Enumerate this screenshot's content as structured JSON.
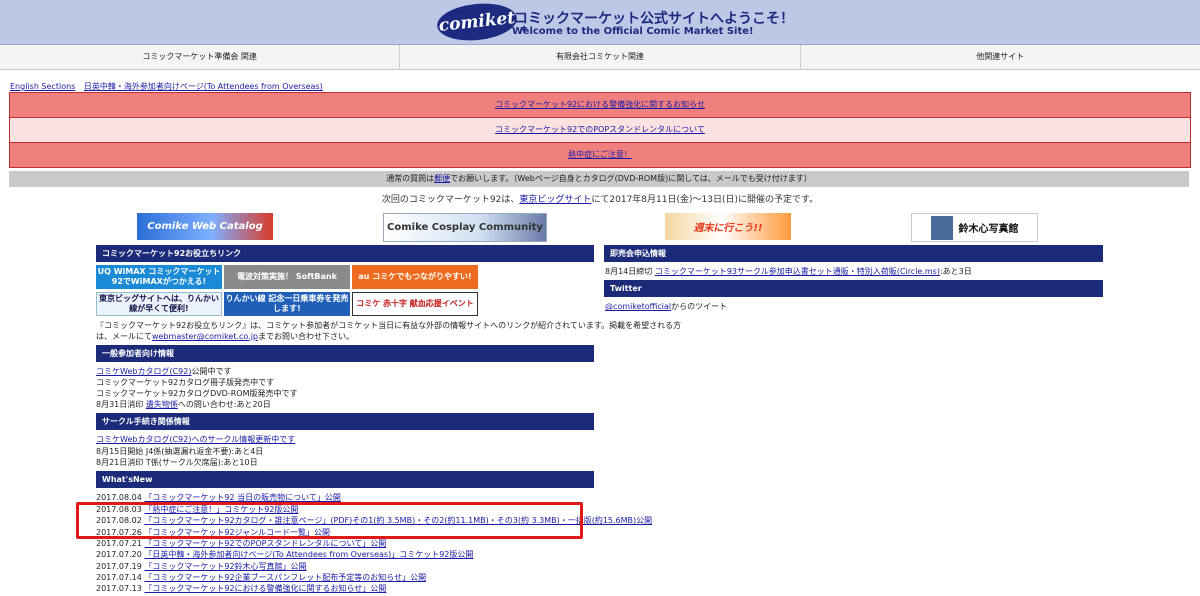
{
  "header": {
    "logo_text": "comiket",
    "logo_star": "★",
    "title_jp": "コミックマーケット公式サイトへようこそ！",
    "title_en": "Welcome to the Official Comic Market Site!"
  },
  "nav": [
    {
      "label": "コミックマーケット準備会 関連"
    },
    {
      "label": "有限会社コミケット関連"
    },
    {
      "label": "他関連サイト"
    }
  ],
  "toplinks": [
    {
      "label": "English Sections"
    },
    {
      "label": "日英中韓・海外参加者向けページ(To Attendees from Overseas)"
    }
  ],
  "notices": [
    {
      "label": "コミックマーケット92における警備強化に関するお知らせ"
    },
    {
      "label": "コミックマーケット92でのPOPスタンドレンタルについて"
    },
    {
      "label": "熱中症にご注意！"
    }
  ],
  "graybar": {
    "prefix": "通常の質問は",
    "link": "郵便",
    "suffix": "でお願いします。（Webページ自身とカタログ(DVD-ROM版)に関しては、メールでも受け付けます）"
  },
  "schedule": {
    "prefix": "次回のコミックマーケット92は、",
    "link": "東京ビッグサイト",
    "suffix": "にて2017年8月11日(金)～13日(日)に開催の予定です。"
  },
  "banners": [
    {
      "label": "Comike Web Catalog"
    },
    {
      "label": "Comike Cosplay Community"
    },
    {
      "label": "週末に行こう!!"
    },
    {
      "label": "鈴木心写真館"
    }
  ],
  "left": {
    "links_title": "コミックマーケット92お役立ちリンク",
    "ads": [
      {
        "label": "UQ WiMAX コミックマーケット92でWiMAXがつかえる!"
      },
      {
        "label": "電波対策実施！ SoftBank"
      },
      {
        "label": "au コミケでもつながりやすい!"
      },
      {
        "label": "東京ビッグサイトへは、りんかい線が早くて便利!"
      },
      {
        "label": "りんかい線 記念一日乗車券を発売します!"
      },
      {
        "label": "コミケ 赤十字 献血応援イベント"
      }
    ],
    "links_desc1": "『コミックマーケット92お役立ちリンク』は、コミケット参加者がコミケット当日に有益な外部の情報サイトへのリンクが紹介されています。掲載を希望される方",
    "links_desc2_prefix": "は、メールにて",
    "links_desc2_link": "webmaster@comiket.co.jp",
    "links_desc2_suffix": "までお問い合わせ下さい。",
    "general_title": "一般参加者向け情報",
    "general_items": [
      {
        "link": "コミケWebカタログ(C92)",
        "text": "公開中です"
      },
      {
        "link": "",
        "text": "コミックマーケット92カタログ冊子版発売中です"
      },
      {
        "link": "",
        "text": "コミックマーケット92カタログDVD-ROM版発売中です"
      },
      {
        "prefix": "8月31日消印",
        "link": "遺失物係",
        "text": "への問い合わせ:あと20日"
      }
    ],
    "circle_title": "サークル手続き関係情報",
    "circle_items": [
      {
        "link": "コミケWebカタログ(C92)へのサークル情報更新中です",
        "text": ""
      },
      {
        "prefix": "8月15日開始",
        "link": "",
        "text": "J4係(抽選漏れ返金不要):あと4日"
      },
      {
        "prefix": "8月21日消印",
        "link": "",
        "text": "T係(サークル欠席届):あと10日"
      }
    ],
    "whatsnew_title": "What'sNew",
    "whatsnew": [
      {
        "date": "2017.08.04",
        "text": "「コミックマーケット92 当日の販売物について」公開"
      },
      {
        "date": "2017.08.03",
        "text": "「熱中症にご注意！」コミケット92版公開"
      },
      {
        "date": "2017.08.02",
        "text": "「コミックマーケット92カタログ・誰注意ページ」(PDF)その1(約 3.5MB)・その2(約11.1MB)・その3(約 3.3MB)・一括版(約15.6MB)公開"
      },
      {
        "date": "2017.07.26",
        "text": "「コミックマーケット92ジャンルコード一覧」公開"
      },
      {
        "date": "2017.07.21",
        "text": "「コミックマーケット92でのPOPスタンドレンタルについて」公開"
      },
      {
        "date": "2017.07.20",
        "text": "「日英中韓・海外参加者向けページ(To Attendees from Overseas)」コミケット92版公開"
      },
      {
        "date": "2017.07.19",
        "text": "「コミックマーケット92鈴木心写真館」公開"
      },
      {
        "date": "2017.07.14",
        "text": "「コミックマーケット92企業ブースパンフレット配布予定等のお知らせ」公開"
      },
      {
        "date": "2017.07.13",
        "text": "「コミックマーケット92における警備強化に関するお知らせ」公開"
      }
    ]
  },
  "right": {
    "sale_title": "即売会申込情報",
    "sale_prefix": "8月14日締切",
    "sale_link": "コミックマーケット93サークル参加申込書セット通販・特別入荷販(Circle.ms)",
    "sale_suffix": ":あと3日",
    "twitter_title": "Twitter",
    "twitter_link": "@comiketofficial",
    "twitter_suffix": "からのツイート"
  }
}
